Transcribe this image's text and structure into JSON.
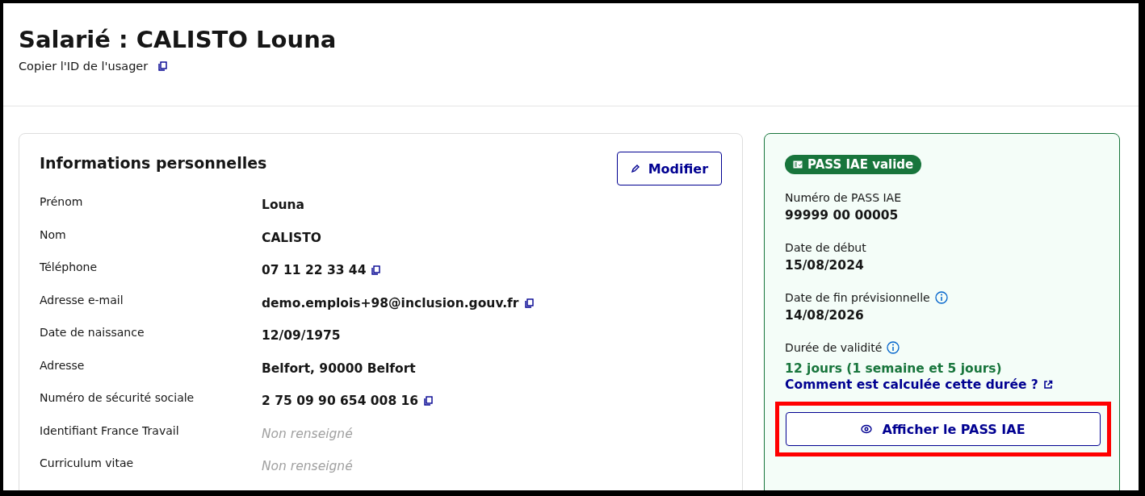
{
  "header": {
    "title": "Salarié : CALISTO Louna",
    "copy_link": "Copier l'ID de l'usager"
  },
  "personal_info": {
    "title": "Informations personnelles",
    "edit_button": "Modifier",
    "rows": [
      {
        "label": "Prénom",
        "value": "Louna",
        "kind": "value",
        "copyable": false
      },
      {
        "label": "Nom",
        "value": "CALISTO",
        "kind": "value",
        "copyable": false
      },
      {
        "label": "Téléphone",
        "value": "07 11 22 33 44",
        "kind": "value",
        "copyable": true
      },
      {
        "label": "Adresse e-mail",
        "value": "demo.emplois+98@inclusion.gouv.fr",
        "kind": "value",
        "copyable": true
      },
      {
        "label": "Date de naissance",
        "value": "12/09/1975",
        "kind": "value",
        "copyable": false
      },
      {
        "label": "Adresse",
        "value": "Belfort, 90000 Belfort",
        "kind": "value",
        "copyable": false
      },
      {
        "label": "Numéro de sécurité sociale",
        "value": "2 75 09 90 654 008 16",
        "kind": "value",
        "copyable": true
      },
      {
        "label": "Identifiant France Travail",
        "value": "Non renseigné",
        "kind": "missing",
        "copyable": false
      },
      {
        "label": "Curriculum vitae",
        "value": "Non renseigné",
        "kind": "missing",
        "copyable": false
      }
    ]
  },
  "pass": {
    "badge": "PASS IAE valide",
    "fields": [
      {
        "label": "Numéro de PASS IAE",
        "value": "99999 00 00005",
        "info": false,
        "kind": "value"
      },
      {
        "label": "Date de début",
        "value": "15/08/2024",
        "info": false,
        "kind": "value"
      },
      {
        "label": "Date de fin prévisionnelle",
        "value": "14/08/2026",
        "info": true,
        "kind": "value"
      },
      {
        "label": "Durée de validité",
        "value": "12 jours (1 semaine et 5 jours)",
        "info": true,
        "kind": "duration"
      }
    ],
    "help_link": "Comment est calculée cette durée ?",
    "show_button": {
      "label": "Afficher le PASS IAE",
      "highlighted": true
    }
  }
}
